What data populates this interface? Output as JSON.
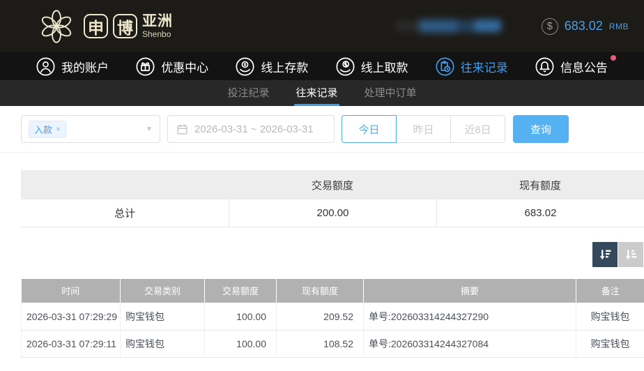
{
  "topbar": {
    "logo": {
      "char1": "申",
      "char2": "博",
      "region": "亚洲",
      "sub": "Shenbo"
    },
    "balance": {
      "amount": "683.02",
      "currency": "RMB",
      "coin_symbol": "$"
    }
  },
  "nav": {
    "items": [
      {
        "label": "我的账户",
        "icon": "user-icon",
        "active": false
      },
      {
        "label": "优惠中心",
        "icon": "gift-icon",
        "active": false
      },
      {
        "label": "线上存款",
        "icon": "deposit-icon",
        "active": false
      },
      {
        "label": "线上取款",
        "icon": "withdraw-icon",
        "active": false
      },
      {
        "label": "往来记录",
        "icon": "records-icon",
        "active": true
      },
      {
        "label": "信息公告",
        "icon": "bell-icon",
        "active": false,
        "has_notification_dot": true
      }
    ]
  },
  "subnav": {
    "tabs": [
      {
        "label": "投注纪录",
        "active": false
      },
      {
        "label": "往来记录",
        "active": true
      },
      {
        "label": "处理中订单",
        "active": false
      }
    ]
  },
  "filters": {
    "type_tag": "入款",
    "type_tag_remove": "×",
    "date_range": "2026-03-31 ~ 2026-03-31",
    "quick_buttons": [
      {
        "label": "今日",
        "active": true
      },
      {
        "label": "昨日",
        "active": false
      },
      {
        "label": "近8日",
        "active": false
      }
    ],
    "search_label": "查询"
  },
  "summary": {
    "headers": [
      "",
      "交易额度",
      "现有额度"
    ],
    "row": {
      "label": "总计",
      "trade_amount": "200.00",
      "current_amount": "683.02"
    }
  },
  "table": {
    "headers": [
      "时间",
      "交易类别",
      "交易额度",
      "现有额度",
      "摘要",
      "备注"
    ],
    "rows": [
      [
        "2026-03-31 07:29:29",
        "购宝钱包",
        "100.00",
        "209.52",
        "单号:202603314244327290",
        "购宝钱包"
      ],
      [
        "2026-03-31 07:29:11",
        "购宝钱包",
        "100.00",
        "108.52",
        "单号:202603314244327084",
        "购宝钱包"
      ]
    ]
  },
  "colors": {
    "accent_blue": "#54abec",
    "nav_active_blue": "#3f9ced",
    "balance_blue": "#4a9fe8",
    "notification_pink": "#e85d7d",
    "sort_dark": "#34495e",
    "logo_cream": "#ece7cc"
  }
}
